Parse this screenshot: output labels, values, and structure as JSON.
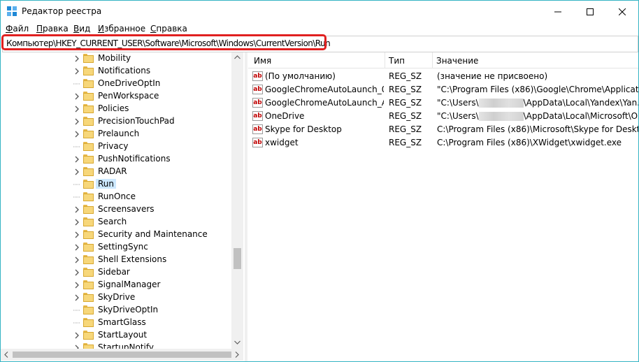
{
  "window": {
    "title": "Редактор реестра"
  },
  "menu": [
    {
      "underline": "Ф",
      "rest": "айл"
    },
    {
      "underline": "П",
      "rest": "равка"
    },
    {
      "underline": "В",
      "rest": "ид"
    },
    {
      "underline": "И",
      "rest": "збранное"
    },
    {
      "underline": "С",
      "rest": "правка"
    }
  ],
  "address": "Компьютер\\HKEY_CURRENT_USER\\Software\\Microsoft\\Windows\\CurrentVersion\\Run",
  "tree": {
    "items": [
      {
        "label": "Mobility",
        "expandable": true,
        "selected": false
      },
      {
        "label": "Notifications",
        "expandable": true,
        "selected": false
      },
      {
        "label": "OneDriveOptIn",
        "expandable": false,
        "selected": false
      },
      {
        "label": "PenWorkspace",
        "expandable": true,
        "selected": false
      },
      {
        "label": "Policies",
        "expandable": true,
        "selected": false
      },
      {
        "label": "PrecisionTouchPad",
        "expandable": true,
        "selected": false
      },
      {
        "label": "Prelaunch",
        "expandable": true,
        "selected": false
      },
      {
        "label": "Privacy",
        "expandable": false,
        "selected": false
      },
      {
        "label": "PushNotifications",
        "expandable": true,
        "selected": false
      },
      {
        "label": "RADAR",
        "expandable": true,
        "selected": false
      },
      {
        "label": "Run",
        "expandable": false,
        "selected": true
      },
      {
        "label": "RunOnce",
        "expandable": false,
        "selected": false
      },
      {
        "label": "Screensavers",
        "expandable": true,
        "selected": false
      },
      {
        "label": "Search",
        "expandable": true,
        "selected": false
      },
      {
        "label": "Security and Maintenance",
        "expandable": true,
        "selected": false
      },
      {
        "label": "SettingSync",
        "expandable": true,
        "selected": false
      },
      {
        "label": "Shell Extensions",
        "expandable": true,
        "selected": false
      },
      {
        "label": "Sidebar",
        "expandable": true,
        "selected": false
      },
      {
        "label": "SignalManager",
        "expandable": true,
        "selected": false
      },
      {
        "label": "SkyDrive",
        "expandable": true,
        "selected": false
      },
      {
        "label": "SkyDriveOptIn",
        "expandable": false,
        "selected": false
      },
      {
        "label": "SmartGlass",
        "expandable": false,
        "selected": false
      },
      {
        "label": "StartLayout",
        "expandable": true,
        "selected": false
      },
      {
        "label": "StartupNotify",
        "expandable": true,
        "selected": false
      }
    ]
  },
  "values": {
    "columns": [
      "Имя",
      "Тип",
      "Значение"
    ],
    "rows": [
      {
        "name": "(По умолчанию)",
        "type": "REG_SZ",
        "value": "(значение не присвоено)",
        "redacted": false
      },
      {
        "name": "GoogleChromeAutoLaunch_0...",
        "type": "REG_SZ",
        "value": "\"C:\\Program Files (x86)\\Google\\Chrome\\Applicati...",
        "redacted": false
      },
      {
        "name": "GoogleChromeAutoLaunch_A...",
        "type": "REG_SZ",
        "value_before": "\"C:\\Users\\",
        "value_after": "\\AppData\\Local\\Yandex\\Yan...",
        "redacted": true
      },
      {
        "name": "OneDrive",
        "type": "REG_SZ",
        "value_before": "\"C:\\Users\\",
        "value_after": "\\AppData\\Local\\Microsoft\\O...",
        "redacted": true
      },
      {
        "name": "Skype for Desktop",
        "type": "REG_SZ",
        "value": "C:\\Program Files (x86)\\Microsoft\\Skype for Deskto...",
        "redacted": false
      },
      {
        "name": "xwidget",
        "type": "REG_SZ",
        "value": "C:\\Program Files (x86)\\XWidget\\xwidget.exe",
        "redacted": false
      }
    ]
  },
  "colors": {
    "accent_border": "#35b4c4",
    "highlight": "#e02020",
    "selection": "#cce8ff",
    "string_icon": "#c00000"
  },
  "icons": {
    "app": "regedit-icon",
    "string_value": "ab-string-icon",
    "folder": "folder-icon"
  }
}
